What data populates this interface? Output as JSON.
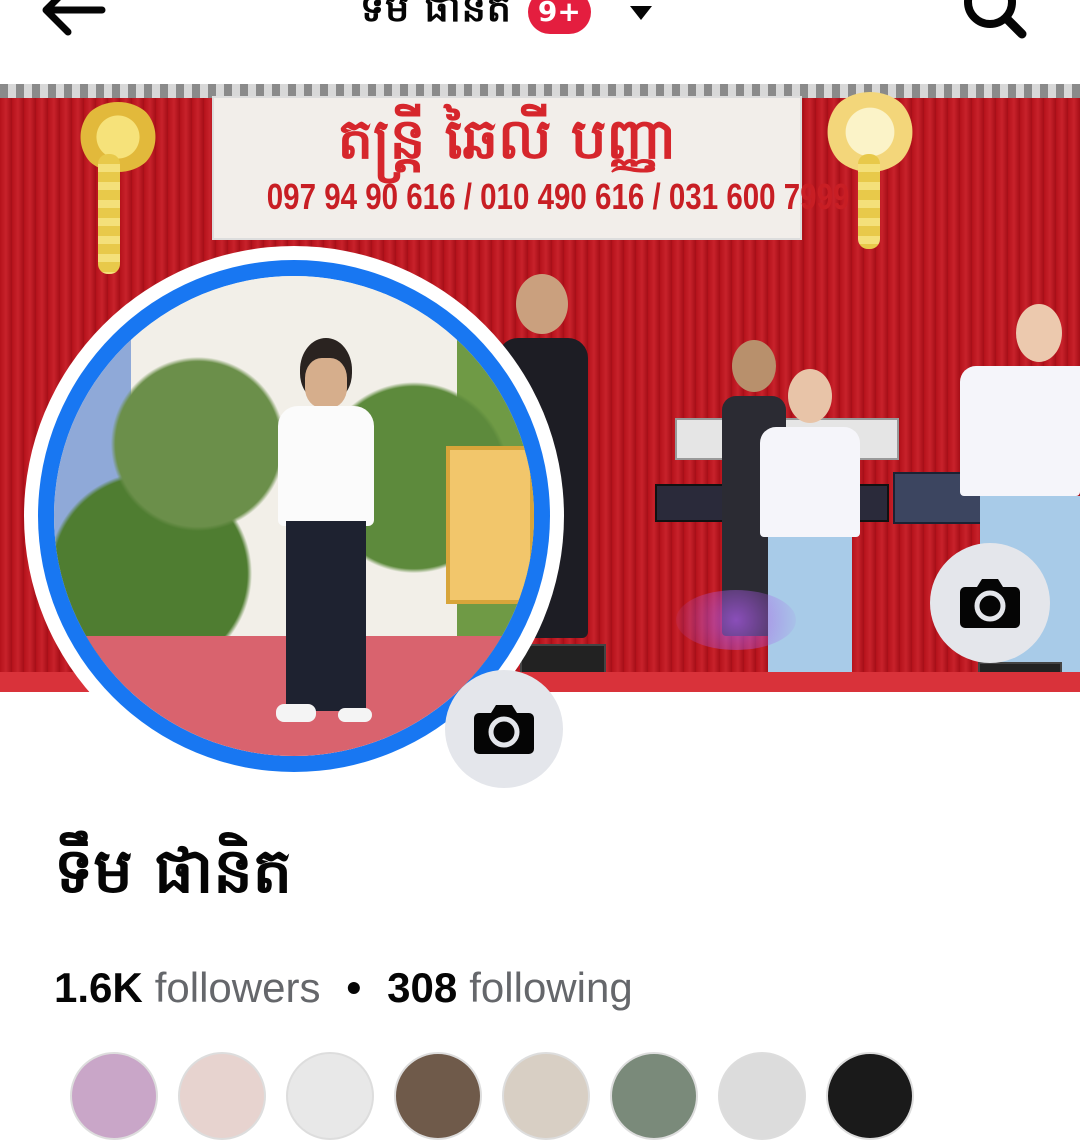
{
  "topbar": {
    "title": "ទឹម ផានិត",
    "notification_badge": "9+",
    "back_icon": "arrow-left-icon",
    "dropdown_icon": "caret-down-icon",
    "search_icon": "search-icon"
  },
  "cover": {
    "banner_title": "តន្ត្រី ឆៃលី បញ្ញា",
    "banner_phone": "097 94 90 616 / 010 490 616 / 031 600 7999",
    "camera_icon": "camera-icon"
  },
  "profile": {
    "name": "ទឹម ផានិត",
    "avatar_camera_icon": "camera-icon",
    "ring_color": "#1877f2"
  },
  "stats": {
    "followers_count": "1.6K",
    "followers_label": "followers",
    "separator": "•",
    "following_count": "308",
    "following_label": "following"
  },
  "friends": {
    "count_visible": 8
  },
  "colors": {
    "accent": "#1877f2",
    "badge": "#e41e3f",
    "secondary_text": "#65676b",
    "icon_button_bg": "#e4e6eb"
  }
}
